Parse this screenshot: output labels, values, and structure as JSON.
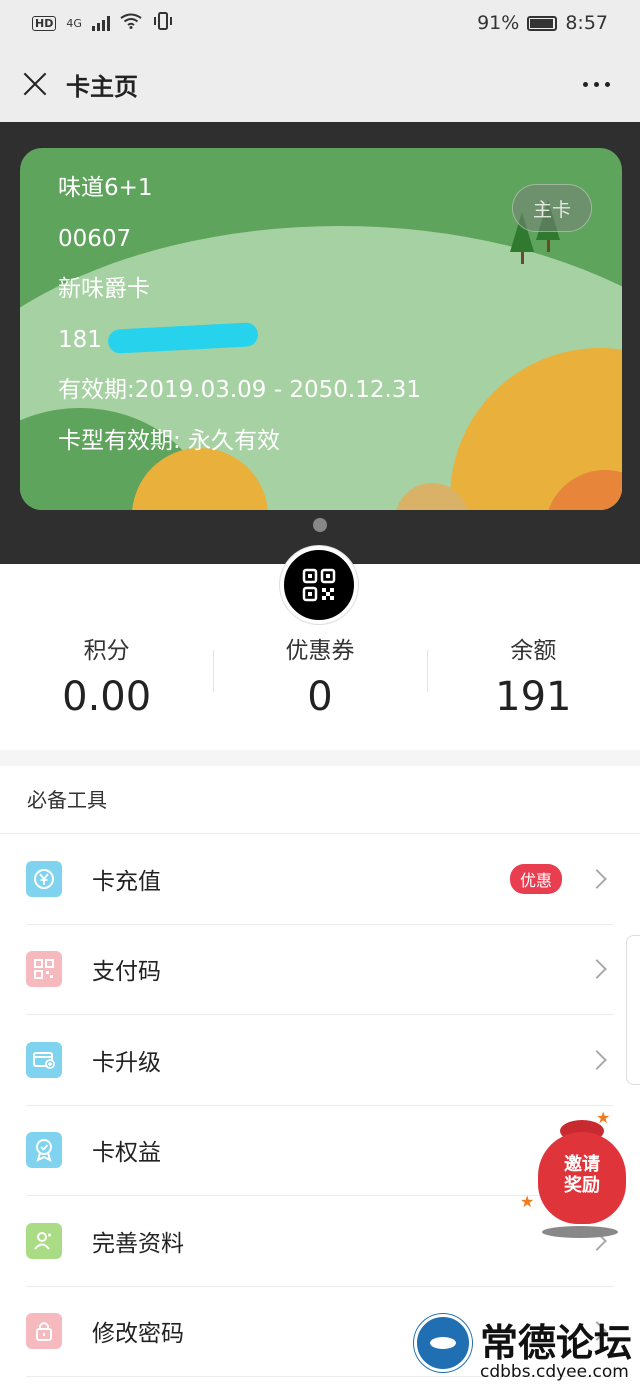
{
  "status_bar": {
    "network": "4G",
    "battery_percent": "91%",
    "time": "8:57",
    "icons": [
      "hd-icon",
      "signal-icon",
      "wifi-icon",
      "vibrate-icon",
      "battery-icon"
    ]
  },
  "nav": {
    "title": "卡主页",
    "close_icon": "close-icon",
    "more_icon": "more-icon"
  },
  "card": {
    "merchant": "味道6+1",
    "card_no": "00607",
    "card_name": "新味爵卡",
    "phone_visible": "181",
    "validity": "有效期:2019.03.09 - 2050.12.31",
    "card_type_validity": "卡型有效期: 永久有效",
    "badge": "主卡",
    "colors": {
      "card_green": "#5fa45d",
      "hill_green": "#a6d1a2",
      "sun_yellow": "#e9b13c",
      "sun_orange": "#e7863a"
    }
  },
  "stats": [
    {
      "label": "积分",
      "value": "0.00"
    },
    {
      "label": "优惠券",
      "value": "0"
    },
    {
      "label": "余额",
      "value": "191"
    }
  ],
  "tools": {
    "title": "必备工具",
    "items": [
      {
        "label": "卡充值",
        "icon": "recharge-icon",
        "badge": "优惠"
      },
      {
        "label": "支付码",
        "icon": "paycode-icon"
      },
      {
        "label": "卡升级",
        "icon": "card-upgrade-icon"
      },
      {
        "label": "卡权益",
        "icon": "card-benefit-icon"
      },
      {
        "label": "完善资料",
        "icon": "profile-icon"
      },
      {
        "label": "修改密码",
        "icon": "lock-icon"
      }
    ]
  },
  "reward": {
    "text_line1": "邀请",
    "text_line2": "奖励"
  },
  "watermark": {
    "title": "常德论坛",
    "url": "cdbbs.cdyee.com"
  },
  "accent_colors": {
    "promo_red": "#e83e4f",
    "nav_bg": "#ededed",
    "card_area_bg": "#2f2f2f"
  }
}
